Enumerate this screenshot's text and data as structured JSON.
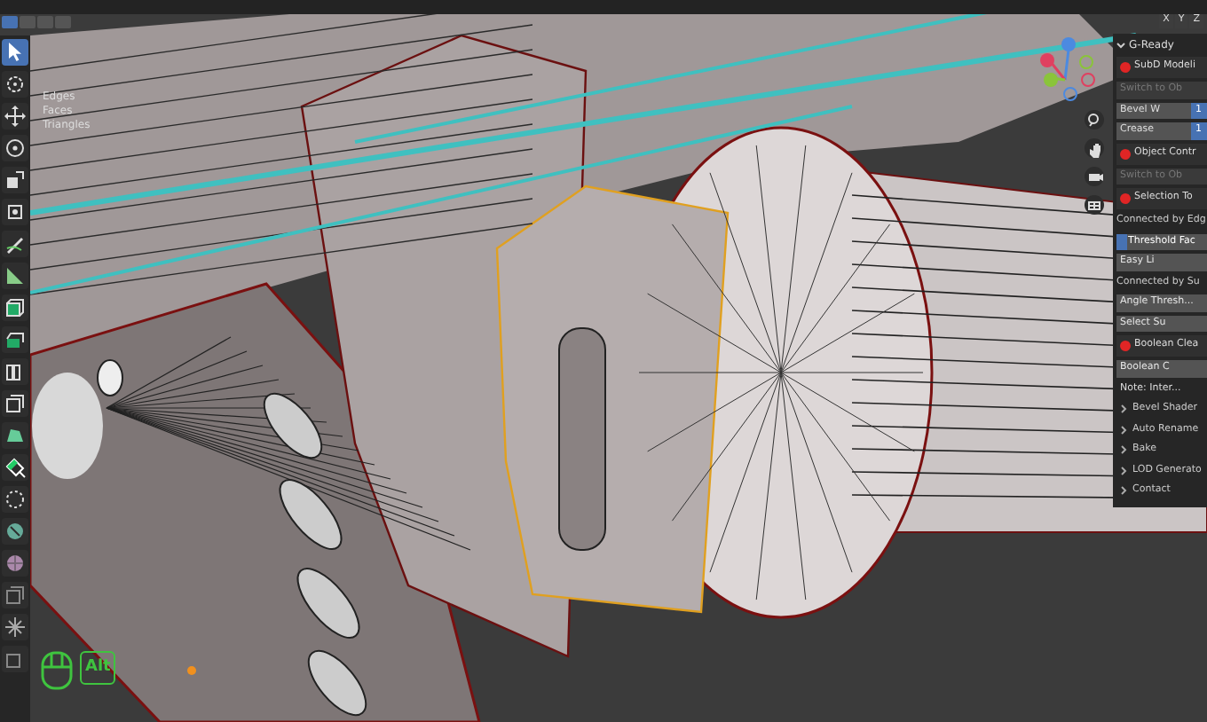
{
  "tools": [
    {
      "selected": true
    },
    {
      "selected": false
    },
    {
      "selected": false
    },
    {
      "selected": false
    },
    {
      "selected": false
    },
    {
      "selected": false
    },
    {
      "selected": false
    },
    {
      "selected": false
    },
    {
      "selected": false
    },
    {
      "selected": false
    },
    {
      "selected": false
    },
    {
      "selected": false
    },
    {
      "selected": false
    },
    {
      "selected": false
    },
    {
      "selected": false
    },
    {
      "selected": false
    },
    {
      "selected": false
    },
    {
      "selected": false
    },
    {
      "selected": false
    },
    {
      "selected": false
    }
  ],
  "stats": [
    "Edges",
    "Faces",
    "Triangles"
  ],
  "mirror_axes": [
    "X",
    "Y",
    "Z"
  ],
  "panel": {
    "title": "G-Ready",
    "expanded": true,
    "rows": [
      {
        "kind": "tool",
        "label": "SubD Modeli"
      },
      {
        "kind": "button",
        "label": "Switch to Ob",
        "disabled": true
      },
      {
        "kind": "field",
        "label": "Bevel W",
        "value": "1"
      },
      {
        "kind": "field",
        "label": "Crease",
        "value": "1"
      },
      {
        "kind": "tool",
        "label": "Object Contr"
      },
      {
        "kind": "button",
        "label": "Switch to Ob",
        "disabled": true
      },
      {
        "kind": "tool",
        "label": "Selection To"
      },
      {
        "kind": "label",
        "label": "Connected by Edg"
      },
      {
        "kind": "slider",
        "label": "Threshold Fac",
        "level": 0.12
      },
      {
        "kind": "button",
        "label": "Easy Li",
        "disabled": false
      },
      {
        "kind": "label",
        "label": "Connected by Su"
      },
      {
        "kind": "button",
        "label": "Angle Thresh...",
        "disabled": false
      },
      {
        "kind": "button",
        "label": "Select Su",
        "disabled": false
      },
      {
        "kind": "tool",
        "label": "Boolean Clea"
      },
      {
        "kind": "button",
        "label": "Boolean C",
        "disabled": false
      },
      {
        "kind": "note",
        "label": "Note: Inter..."
      },
      {
        "kind": "subpanel",
        "label": "Bevel Shader",
        "expanded": false
      },
      {
        "kind": "subpanel",
        "label": "Auto Rename",
        "expanded": false
      },
      {
        "kind": "subpanel",
        "label": "Bake",
        "expanded": false
      },
      {
        "kind": "subpanel",
        "label": "LOD Generato",
        "expanded": false
      },
      {
        "kind": "subpanel",
        "label": "Contact",
        "expanded": false
      }
    ]
  },
  "key_overlay": {
    "label": "Alt"
  }
}
